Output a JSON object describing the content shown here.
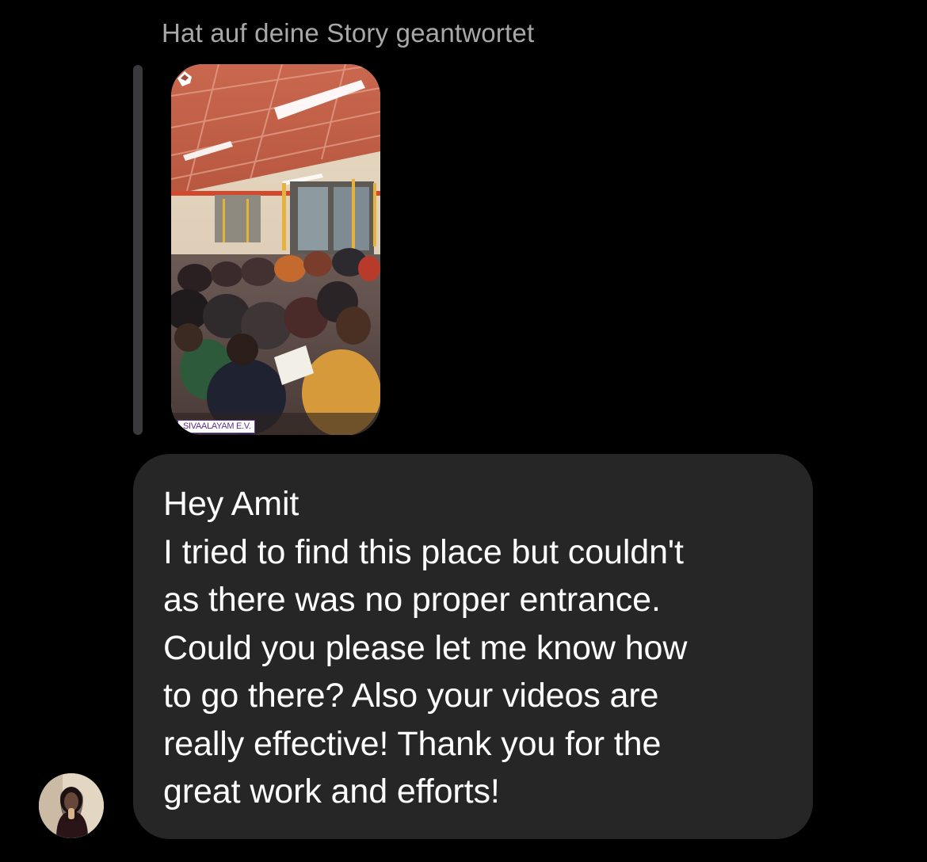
{
  "conversation": {
    "reply_caption": "Hat auf deine Story geantwortet",
    "story": {
      "tag_text": "SIVAALAYAM E.V.",
      "icon": "story-sticker-icon"
    },
    "message": {
      "lines": [
        "Hey Amit",
        "I tried to find this place but couldn't",
        "as there was no proper entrance.",
        "Could you please let me know how",
        "to go there? Also your videos are",
        "really effective! Thank you for the",
        "great work and efforts!"
      ]
    },
    "sender": {
      "avatar": "avatar-photo"
    }
  },
  "colors": {
    "background": "#000000",
    "bubble": "#262626",
    "caption_text": "#a8a8a8",
    "message_text": "#ffffff",
    "reply_bar": "#3a3a3c"
  }
}
